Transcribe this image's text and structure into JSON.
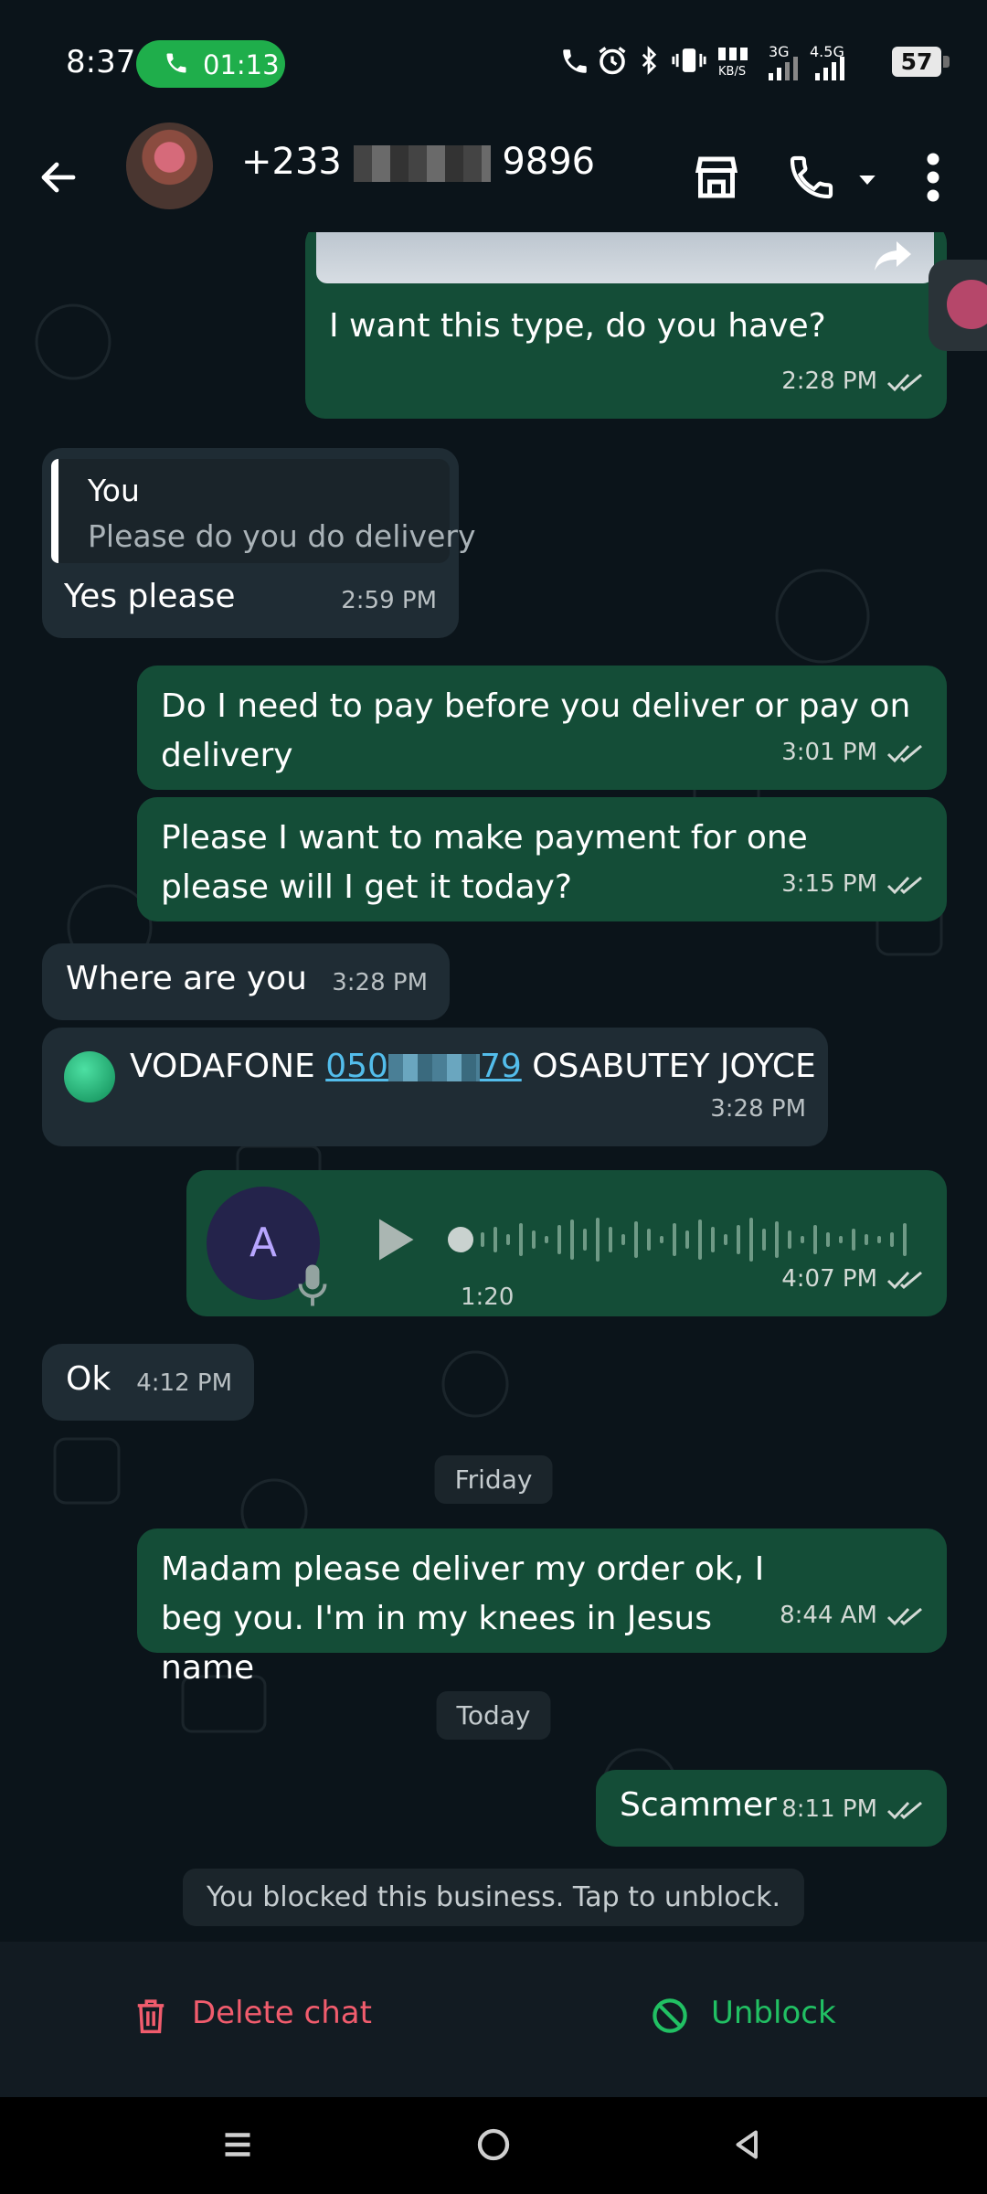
{
  "status_bar": {
    "time": "8:37",
    "call_duration": "01:13",
    "battery": "57",
    "icons": [
      "wifi-call-icon",
      "alarm-icon",
      "bluetooth-icon",
      "vibrate-icon",
      "data-speed-icon",
      "signal-3g-icon",
      "signal-4.5g-icon",
      "battery-icon"
    ],
    "data_speed": "KB/S",
    "net1": "3G",
    "net2": "4.5G"
  },
  "header": {
    "contact_prefix": "+233",
    "contact_suffix": "9896",
    "icons": [
      "back-arrow-icon",
      "store-icon",
      "phone-icon",
      "dropdown-icon",
      "more-icon"
    ]
  },
  "messages": [
    {
      "id": "m1",
      "direction": "out",
      "text": "I want this type, do you have?",
      "time": "2:28 PM",
      "ticks": "read"
    },
    {
      "id": "m2",
      "direction": "in",
      "quote_author": "You",
      "quote_text": "Please do you do delivery",
      "text": "Yes please",
      "time": "2:59 PM"
    },
    {
      "id": "m3",
      "direction": "out",
      "text": "Do I need to pay before you deliver or pay on delivery",
      "time": "3:01 PM",
      "ticks": "read"
    },
    {
      "id": "m4",
      "direction": "out",
      "text": "Please I want to make payment for one please will I get it today?",
      "time": "3:15 PM",
      "ticks": "read"
    },
    {
      "id": "m5",
      "direction": "in",
      "text": "Where are you",
      "time": "3:28 PM"
    },
    {
      "id": "m6",
      "direction": "in",
      "prefix": "VODAFONE",
      "link": "0507  79",
      "suffix": "OSABUTEY JOYCE",
      "time": "3:28 PM"
    },
    {
      "id": "m7",
      "direction": "out",
      "type": "voice",
      "avatar_letter": "A",
      "duration": "1:20",
      "time": "4:07 PM",
      "ticks": "read"
    },
    {
      "id": "m8",
      "direction": "in",
      "text": "Ok",
      "time": "4:12 PM"
    },
    {
      "id": "m9",
      "direction": "out",
      "text": "Madam please deliver my order ok, I beg you. I'm in my knees in Jesus name",
      "time": "8:44 AM",
      "ticks": "read"
    },
    {
      "id": "m10",
      "direction": "out",
      "text": "Scammer",
      "time": "8:11 PM",
      "ticks": "read"
    }
  ],
  "date_chips": {
    "friday": "Friday",
    "today": "Today"
  },
  "blocked_notice": "You blocked this business. Tap to unblock.",
  "actions": {
    "delete": "Delete chat",
    "unblock": "Unblock"
  },
  "nav_icons": [
    "menu-icon",
    "home-icon",
    "back-icon"
  ]
}
